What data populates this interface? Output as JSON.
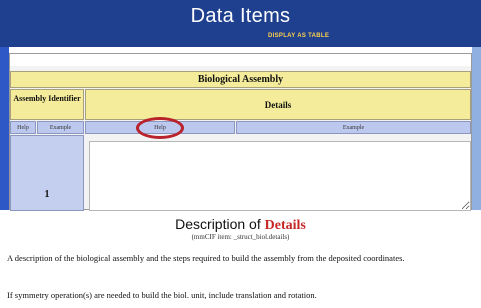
{
  "header": {
    "title": "Data Items",
    "display_link": "DISPLAY AS TABLE"
  },
  "table": {
    "caption": "Biological Assembly",
    "assembly_header": "Assembly Identifier",
    "details_header": "Details",
    "sub_help_left": "Help",
    "sub_example_left": "Example",
    "sub_help_right": "Help",
    "sub_example_right": "Example",
    "row_id": "1",
    "details_value": ""
  },
  "description": {
    "heading_prefix": "Description of",
    "heading_term": "Details",
    "subtitle": "(mmCIF item: _struct_biol.details)",
    "para1": "A description of the biological assembly and the steps required to build the assembly from the deposited coordinates.",
    "para2": "If symmetry operation(s) are needed to build the biol. unit, include translation and rotation."
  },
  "colors": {
    "header_bg": "#1f3f8f",
    "table_yellow": "#f4ec9a",
    "table_blue": "#bcc8ee",
    "highlight_ring": "#b8232c",
    "term_red": "#c62828"
  }
}
